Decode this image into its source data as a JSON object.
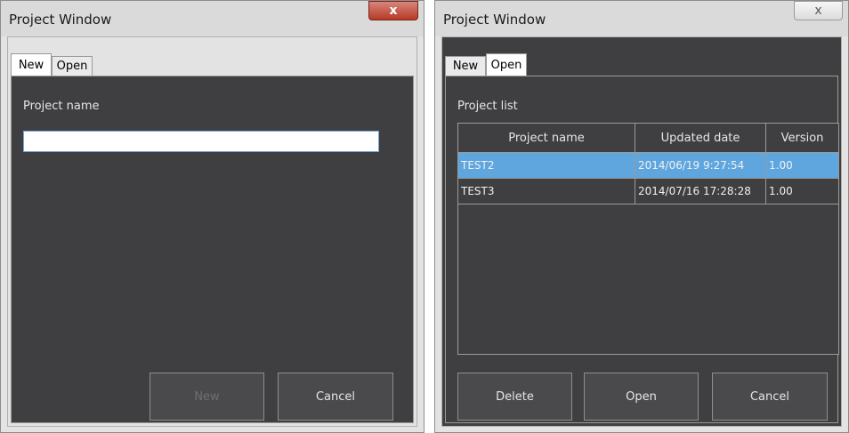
{
  "left_window": {
    "title": "Project Window",
    "close_glyph": "x",
    "tabs": [
      {
        "label": "New",
        "active": true
      },
      {
        "label": "Open",
        "active": false
      }
    ],
    "field_label": "Project name",
    "field_value": "",
    "buttons": {
      "new": "New",
      "cancel": "Cancel"
    }
  },
  "right_window": {
    "title": "Project Window",
    "close_glyph": "x",
    "tabs": [
      {
        "label": "New",
        "active": false
      },
      {
        "label": "Open",
        "active": true
      }
    ],
    "list_label": "Project list",
    "columns": [
      "Project name",
      "Updated date",
      "Version"
    ],
    "rows": [
      {
        "name": "TEST2",
        "date": "2014/06/19 9:27:54",
        "version": "1.00",
        "selected": true
      },
      {
        "name": "TEST3",
        "date": "2014/07/16 17:28:28",
        "version": "1.00",
        "selected": false
      }
    ],
    "buttons": {
      "delete": "Delete",
      "open": "Open",
      "cancel": "Cancel"
    }
  },
  "colors": {
    "panel_bg": "#3f3f41",
    "selected_row": "#5fa6df",
    "close_active": "#c9493a"
  }
}
